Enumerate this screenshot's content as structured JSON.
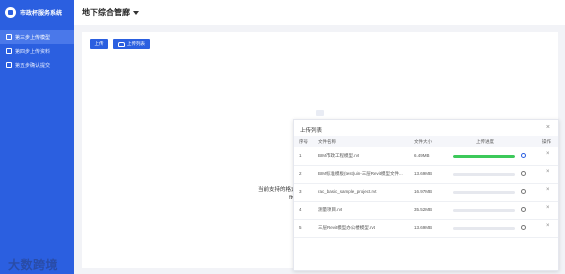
{
  "app": {
    "title": "市政杯服务系统"
  },
  "header": {
    "title": "地下综合管廊"
  },
  "sidebar": {
    "items": [
      {
        "label": "第三步上传模型",
        "active": true
      },
      {
        "label": "第四步上传资料",
        "active": false
      },
      {
        "label": "第五步确认提交",
        "active": false
      }
    ]
  },
  "toolbar": {
    "upload_label": "上传",
    "list_label": "上传列表"
  },
  "main": {
    "supported_label": "当前支持的格式:",
    "supported_value": "ftv_"
  },
  "modal": {
    "title": "上传列表",
    "columns": [
      "序号",
      "文件名称",
      "文件大小",
      "上传进度",
      "操作"
    ],
    "rows": [
      {
        "index": "1",
        "name": "BIM市政工程模型.rvt",
        "size": "6.49MB",
        "progress": 1.0
      },
      {
        "index": "2",
        "name": "BIM标准模板(test)uin-三层Revit模型文件...",
        "size": "13.69MB",
        "progress": 0
      },
      {
        "index": "3",
        "name": "rac_basic_sample_project.rvt",
        "size": "16.97MB",
        "progress": 0
      },
      {
        "index": "4",
        "name": "测量项目.rvt",
        "size": "35.52MB",
        "progress": 0
      },
      {
        "index": "5",
        "name": "三层Revit模型办公楼模型.rvt",
        "size": "13.69MB",
        "progress": 0
      }
    ]
  },
  "watermark": {
    "text": "大数跨境"
  },
  "colors": {
    "primary": "#2b5fe0",
    "progress_done": "#3cc95a"
  }
}
